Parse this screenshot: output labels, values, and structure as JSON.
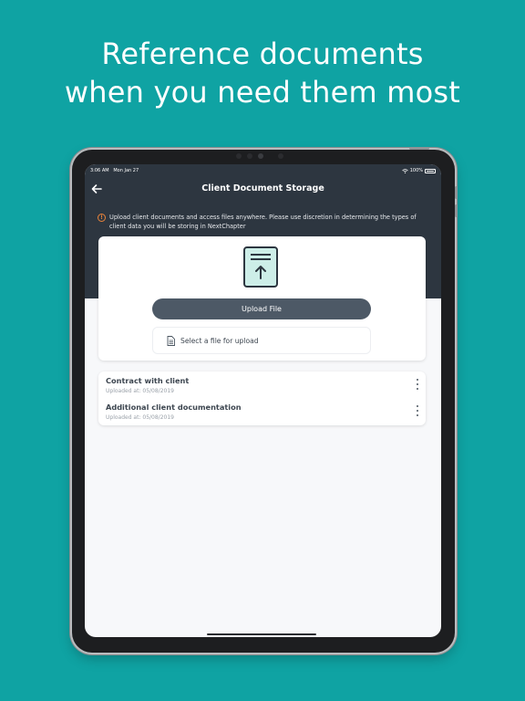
{
  "headline": {
    "line1": "Reference documents",
    "line2": "when you need them most"
  },
  "colors": {
    "background": "#0fa3a3",
    "header": "#2d3640",
    "accent_warning": "#e8833a",
    "upload_button": "#4d5966",
    "illustration_fill": "#cdeee8"
  },
  "status_bar": {
    "time": "3:06 AM",
    "date": "Mon Jan 27",
    "battery": "100%"
  },
  "header": {
    "title": "Client Document Storage",
    "back_icon": "arrow-left-icon"
  },
  "notice": {
    "icon": "info-icon",
    "icon_glyph": "!",
    "text": "Upload client documents and access files anywhere. Please use discretion in determining the types of client data you will be storing in NextChapter"
  },
  "upload": {
    "illustration_icon": "upload-document-icon",
    "button_label": "Upload File",
    "select_label": "Select a file for upload",
    "select_icon": "file-icon"
  },
  "files": [
    {
      "name": "Contract with client",
      "uploaded": "Uploaded at: 05/08/2019",
      "menu_icon": "more-vertical-icon"
    },
    {
      "name": "Additional client documentation",
      "uploaded": "Uploaded at: 05/08/2019",
      "menu_icon": "more-vertical-icon"
    }
  ]
}
